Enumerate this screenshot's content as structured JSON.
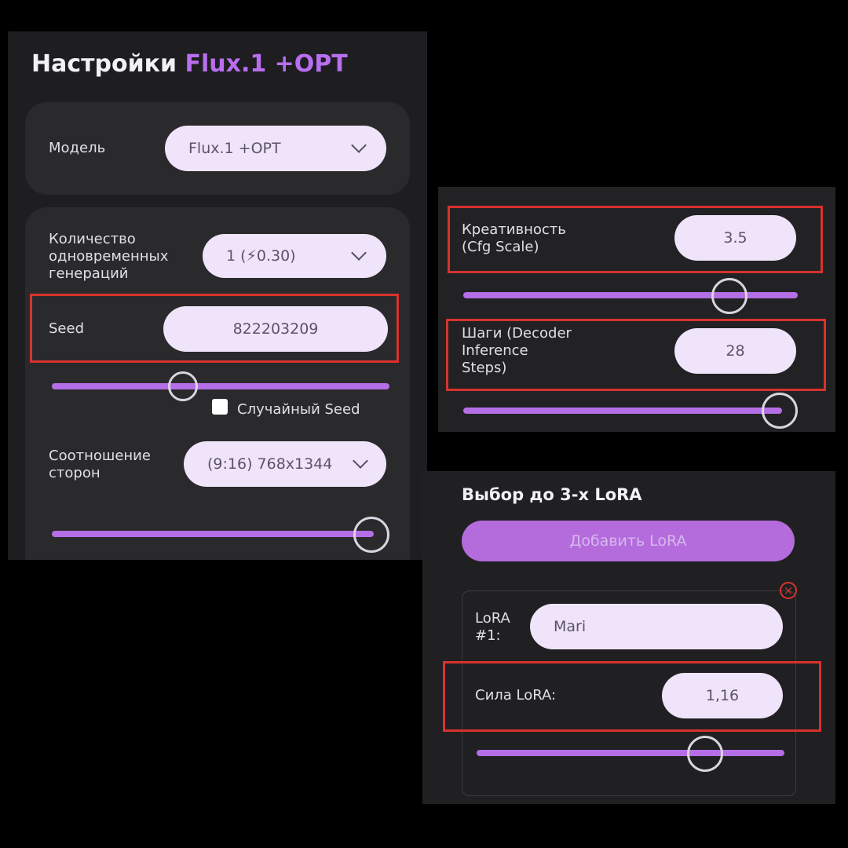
{
  "left": {
    "title_prefix": "Настройки ",
    "title_accent": "Flux.1 +OPT",
    "model_label": "Модель",
    "model_value": "Flux.1 +OPT",
    "count_label": "Количество\nодновременных\nгенераций",
    "count_value": "1 (⚡0.30)",
    "seed_label": "Seed",
    "seed_value": "822203209",
    "seed_slider": 0.4,
    "random_seed_label": "Случайный Seed",
    "random_seed_checked": false,
    "ratio_label": "Соотношение\nсторон",
    "ratio_value": "(9:16) 768x1344",
    "ratio_slider": 1.0
  },
  "right_top": {
    "cfg_label": "Креативность\n(Cfg Scale)",
    "cfg_value": "3.5",
    "cfg_slider": 0.8,
    "steps_label": "Шаги (Decoder\nInference\nSteps)",
    "steps_value": "28",
    "steps_slider": 1.0
  },
  "lora": {
    "heading": "Выбор до 3-х LoRA",
    "add_button": "Добавить LoRA",
    "item_label": "LoRA\n#1:",
    "item_value": "Mari",
    "strength_label": "Сила LoRA:",
    "strength_value": "1,16",
    "strength_slider": 0.75
  },
  "colors": {
    "accent": "#b96ef0",
    "highlight": "#d8322e",
    "pill": "#f0e4fb"
  }
}
